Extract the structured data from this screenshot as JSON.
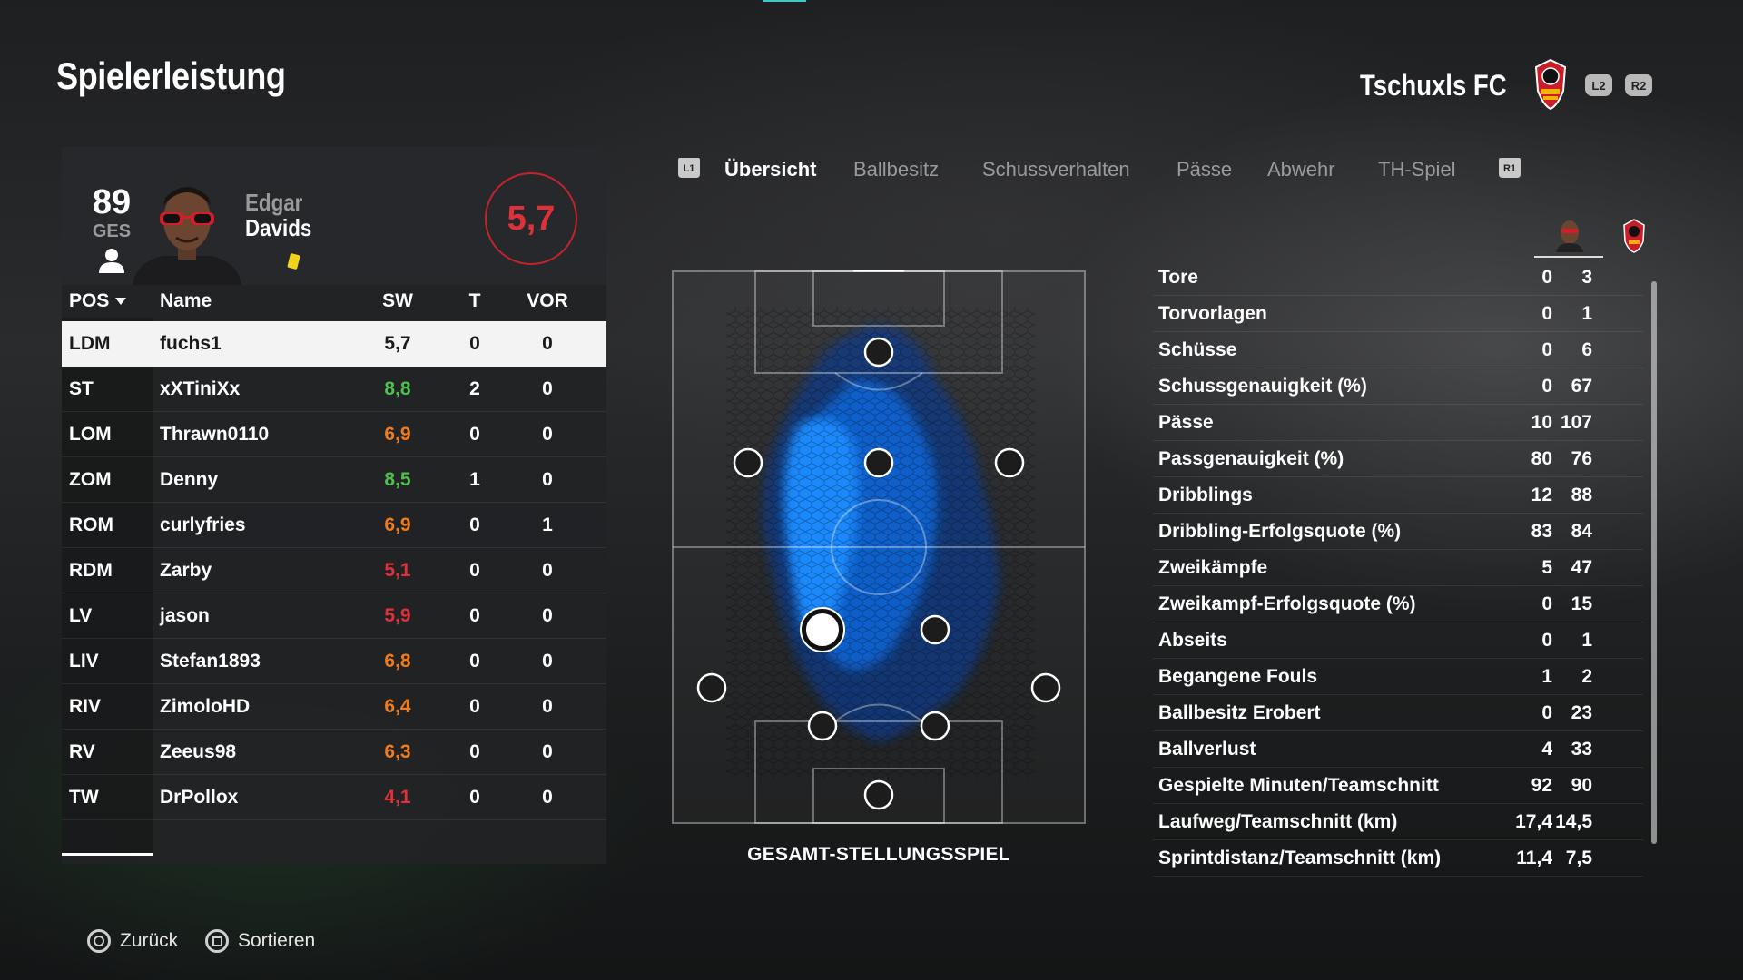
{
  "header": {
    "title": "Spielerleistung",
    "team_name": "Tschuxls FC",
    "hint_l2": "L2",
    "hint_r2": "R2"
  },
  "player": {
    "overall": "89",
    "overall_label": "GES",
    "first_name": "Edgar",
    "last_name": "Davids",
    "rating": "5,7"
  },
  "table": {
    "headers": {
      "pos": "POS",
      "name": "Name",
      "sw": "SW",
      "t": "T",
      "vor": "VOR"
    },
    "rows": [
      {
        "pos": "LDM",
        "name": "fuchs1",
        "sw": "5,7",
        "t": "0",
        "vor": "0",
        "sw_color": "#1a1a1a"
      },
      {
        "pos": "ST",
        "name": "xXTiniXx",
        "sw": "8,8",
        "t": "2",
        "vor": "0",
        "sw_color": "#4cc24c"
      },
      {
        "pos": "LOM",
        "name": "Thrawn0110",
        "sw": "6,9",
        "t": "0",
        "vor": "0",
        "sw_color": "#f07b1c"
      },
      {
        "pos": "ZOM",
        "name": "Denny",
        "sw": "8,5",
        "t": "1",
        "vor": "0",
        "sw_color": "#4cc24c"
      },
      {
        "pos": "ROM",
        "name": "curlyfries",
        "sw": "6,9",
        "t": "0",
        "vor": "1",
        "sw_color": "#f07b1c"
      },
      {
        "pos": "RDM",
        "name": "Zarby",
        "sw": "5,1",
        "t": "0",
        "vor": "0",
        "sw_color": "#e0303a"
      },
      {
        "pos": "LV",
        "name": "jason",
        "sw": "5,9",
        "t": "0",
        "vor": "0",
        "sw_color": "#e0303a"
      },
      {
        "pos": "LIV",
        "name": "Stefan1893",
        "sw": "6,8",
        "t": "0",
        "vor": "0",
        "sw_color": "#f07b1c"
      },
      {
        "pos": "RIV",
        "name": "ZimoloHD",
        "sw": "6,4",
        "t": "0",
        "vor": "0",
        "sw_color": "#f07b1c"
      },
      {
        "pos": "RV",
        "name": "Zeeus98",
        "sw": "6,3",
        "t": "0",
        "vor": "0",
        "sw_color": "#f07b1c"
      },
      {
        "pos": "TW",
        "name": "DrPollox",
        "sw": "4,1",
        "t": "0",
        "vor": "0",
        "sw_color": "#e0303a"
      }
    ]
  },
  "tabs": {
    "l1": "L1",
    "r1": "R1",
    "items": [
      "Übersicht",
      "Ballbesitz",
      "Schussverhalten",
      "Pässe",
      "Abwehr",
      "TH-Spiel"
    ],
    "active": "Übersicht"
  },
  "pitch": {
    "label": "GESAMT-STELLUNGSSPIEL",
    "heat_color": "#1a8cff"
  },
  "stats": [
    {
      "label": "Tore",
      "player": "0",
      "team": "3"
    },
    {
      "label": "Torvorlagen",
      "player": "0",
      "team": "1"
    },
    {
      "label": "Schüsse",
      "player": "0",
      "team": "6"
    },
    {
      "label": "Schussgenauigkeit (%)",
      "player": "0",
      "team": "67"
    },
    {
      "label": "Pässe",
      "player": "10",
      "team": "107"
    },
    {
      "label": "Passgenauigkeit (%)",
      "player": "80",
      "team": "76"
    },
    {
      "label": "Dribblings",
      "player": "12",
      "team": "88"
    },
    {
      "label": "Dribbling-Erfolgsquote (%)",
      "player": "83",
      "team": "84"
    },
    {
      "label": "Zweikämpfe",
      "player": "5",
      "team": "47"
    },
    {
      "label": "Zweikampf-Erfolgsquote (%)",
      "player": "0",
      "team": "15"
    },
    {
      "label": "Abseits",
      "player": "0",
      "team": "1"
    },
    {
      "label": "Begangene Fouls",
      "player": "1",
      "team": "2"
    },
    {
      "label": "Ballbesitz Erobert",
      "player": "0",
      "team": "23"
    },
    {
      "label": "Ballverlust",
      "player": "4",
      "team": "33"
    },
    {
      "label": "Gespielte Minuten/Teamschnitt",
      "player": "92",
      "team": "90"
    },
    {
      "label": "Laufweg/Teamschnitt (km)",
      "player": "17,4",
      "team": "14,5"
    },
    {
      "label": "Sprintdistanz/Teamschnitt (km)",
      "player": "11,4",
      "team": "7,5"
    }
  ],
  "footer": {
    "back_label": "Zurück",
    "sort_label": "Sortieren"
  },
  "colors": {
    "rating_red": "#e0303a",
    "good_green": "#4cc24c",
    "mid_orange": "#f07b1c"
  }
}
